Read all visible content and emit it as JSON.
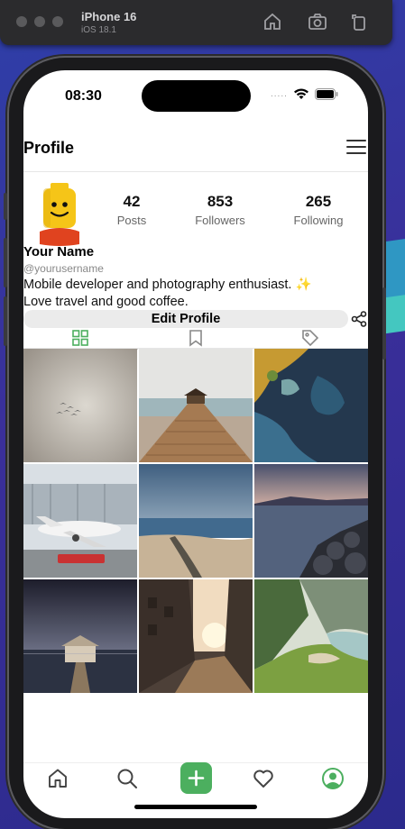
{
  "simulator": {
    "device": "iPhone 16",
    "os": "iOS 18.1"
  },
  "status_bar": {
    "time": "08:30",
    "signal": "....."
  },
  "header": {
    "title": "Profile"
  },
  "profile": {
    "stats": [
      {
        "value": "42",
        "label": "Posts"
      },
      {
        "value": "853",
        "label": "Followers"
      },
      {
        "value": "265",
        "label": "Following"
      }
    ],
    "name": "Your Name",
    "username": "@yourusername",
    "bio_line1": "Mobile developer and photography enthusiast. ",
    "bio_emoji": "✨",
    "bio_line2": "Love travel and good coffee.",
    "edit_label": "Edit Profile"
  },
  "tabs": [
    {
      "icon": "grid-icon",
      "active": true
    },
    {
      "icon": "bookmark-icon",
      "active": false
    },
    {
      "icon": "tag-icon",
      "active": false
    }
  ],
  "grid_photos": [
    "birds-in-fog",
    "pier-with-gazebo",
    "aerial-coast",
    "airplane-on-tarmac",
    "beach-shadows",
    "rocky-shore-sunset",
    "boathouse-at-night",
    "sunset-street",
    "green-coastal-cliffs"
  ],
  "bottom_nav": [
    {
      "icon": "home-icon"
    },
    {
      "icon": "search-icon"
    },
    {
      "icon": "plus-icon"
    },
    {
      "icon": "heart-icon"
    },
    {
      "icon": "profile-icon"
    }
  ],
  "colors": {
    "accent": "#4caf5f",
    "active_tab": "#4caf5f",
    "inactive_icon": "#888888"
  }
}
